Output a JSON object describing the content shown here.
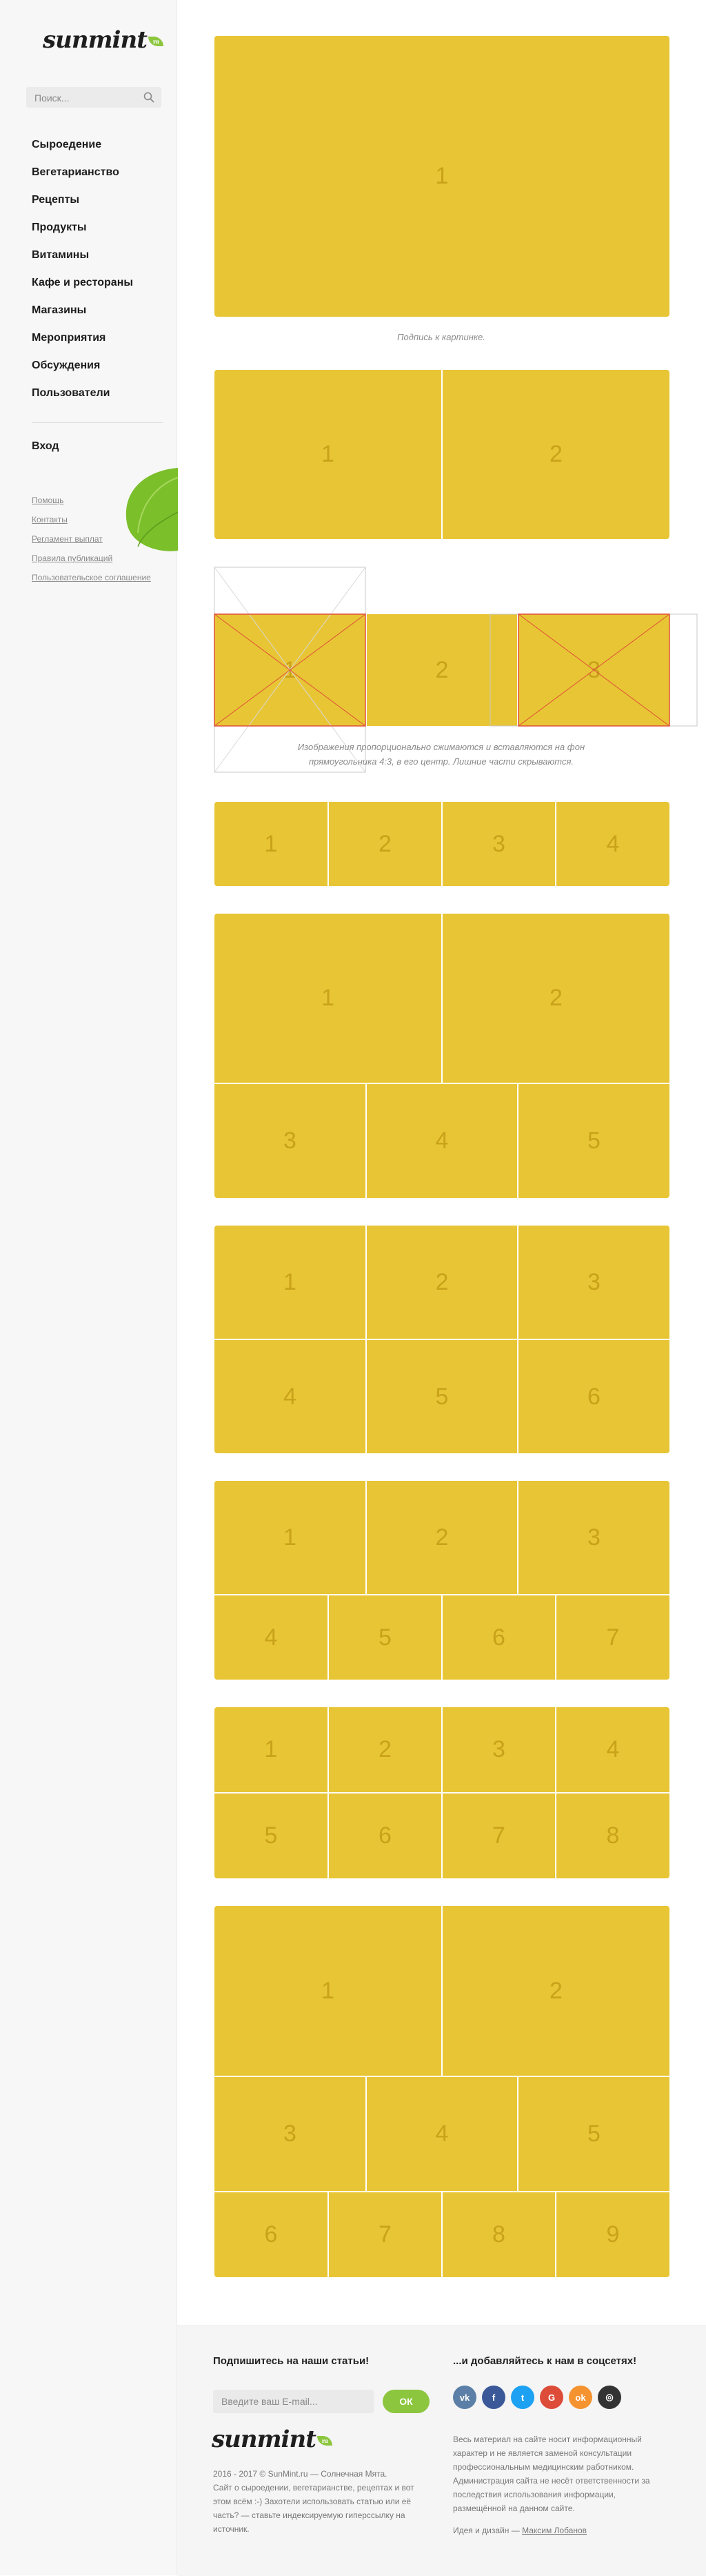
{
  "sidebar": {
    "logo": "sunmint",
    "logo_badge": "ru",
    "search_placeholder": "Поиск...",
    "nav": [
      "Сыроедение",
      "Вегетарианство",
      "Рецепты",
      "Продукты",
      "Витамины",
      "Кафе и рестораны",
      "Магазины",
      "Мероприятия",
      "Обсуждения",
      "Пользователи"
    ],
    "login": "Вход",
    "links": [
      "Помощь",
      "Контакты",
      "Регламент выплат",
      "Правила публикаций",
      "Пользовательское соглашение"
    ]
  },
  "main": {
    "caption1": "Подпись к картинке.",
    "caption2": "Изображения пропорционально сжимаются и вставляются на фон прямоугольника 4:3, в его центр. Лишние части скрываются.",
    "tile_accent": "#e8c534",
    "tile_number_color": "#c9a21a",
    "galleries": [
      [
        "1"
      ],
      [
        "1",
        "2"
      ],
      [
        "1",
        "2",
        "3"
      ],
      [
        "1",
        "2",
        "3",
        "4"
      ],
      [
        "1",
        "2",
        "3",
        "4",
        "5"
      ],
      [
        "1",
        "2",
        "3",
        "4",
        "5",
        "6"
      ],
      [
        "1",
        "2",
        "3",
        "4",
        "5",
        "6",
        "7"
      ],
      [
        "1",
        "2",
        "3",
        "4",
        "5",
        "6",
        "7",
        "8"
      ],
      [
        "1",
        "2",
        "3",
        "4",
        "5",
        "6",
        "7",
        "8",
        "9"
      ]
    ]
  },
  "footer": {
    "subscribe_title": "Подпишитесь на наши статьи!",
    "email_placeholder": "Введите ваш E-mail...",
    "ok_button": "ОК",
    "social_title": "...и добавляйтесь к нам в соцсетях!",
    "socials": [
      {
        "name": "vk-icon",
        "label": "vk",
        "color": "#5b7fa6"
      },
      {
        "name": "facebook-icon",
        "label": "f",
        "color": "#3b5998"
      },
      {
        "name": "twitter-icon",
        "label": "t",
        "color": "#1da1f2"
      },
      {
        "name": "google-icon",
        "label": "G",
        "color": "#dd4b39"
      },
      {
        "name": "odnoklassniki-icon",
        "label": "ok",
        "color": "#f59331"
      },
      {
        "name": "instagram-icon",
        "label": "◎",
        "color": "#333333"
      }
    ],
    "logo": "sunmint",
    "logo_badge": "ru",
    "copyright": "2016 - 2017 © SunMint.ru — Солнечная Мята.",
    "copyright_text": "Сайт о сыроедении, вегетарианстве, рецептах и вот этом всём :-) Захотели использовать статью или её часть? — ставьте индексируемую гиперссылку на источник.",
    "disclaimer": "Весь материал на сайте носит информационный характер и не является заменой консультации профессиональным медицинским работником. Администрация сайта не несёт ответственности за последствия использования информации, размещённой на данном сайте.",
    "design_prefix": "Идея и дизайн —",
    "design_author": "Максим Лобанов"
  }
}
